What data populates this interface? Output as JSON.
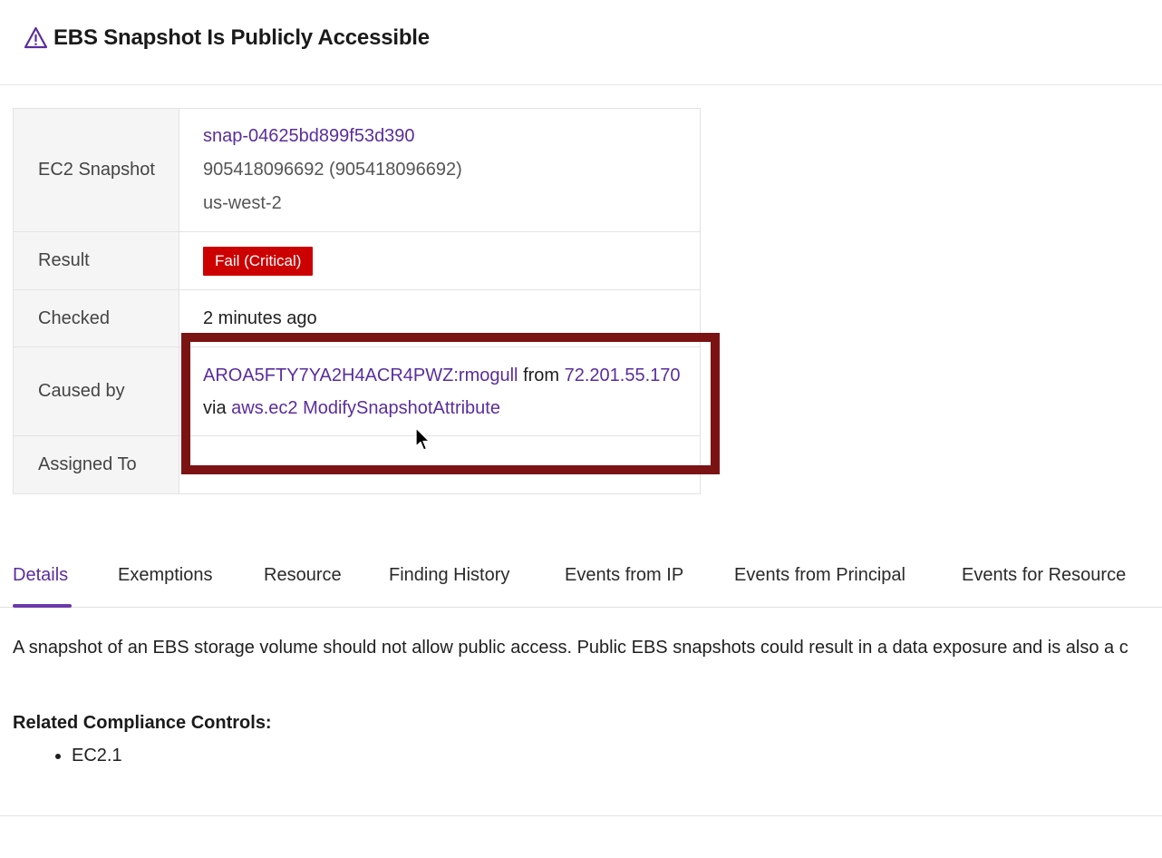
{
  "header": {
    "title": "EBS Snapshot Is Publicly Accessible",
    "icon": "warning-triangle-icon"
  },
  "info": {
    "snapshot_label": "EC2 Snapshot",
    "snapshot_id": "snap-04625bd899f53d390",
    "account": "905418096692 (905418096692)",
    "region": "us-west-2",
    "result_label": "Result",
    "result_value": "Fail (Critical)",
    "checked_label": "Checked",
    "checked_value": "2 minutes ago",
    "caused_label": "Caused by",
    "principal": "AROA5FTY7YA2H4ACR4PWZ:rmogull",
    "from_text": "from",
    "ip": "72.201.55.170",
    "via_text": "via",
    "event": "aws.ec2 ModifySnapshotAttribute",
    "assigned_label": "Assigned To",
    "assigned_value": ""
  },
  "tabs": [
    {
      "label": "Details",
      "active": true
    },
    {
      "label": "Exemptions"
    },
    {
      "label": "Resource"
    },
    {
      "label": "Finding History"
    },
    {
      "label": "Events from IP"
    },
    {
      "label": "Events from Principal"
    },
    {
      "label": "Events for Resource"
    }
  ],
  "details": {
    "description": "A snapshot of an EBS storage volume should not allow public access. Public EBS snapshots could result in a data exposure and is also a c",
    "compliance_title": "Related Compliance Controls:",
    "controls": [
      "EC2.1"
    ]
  },
  "colors": {
    "accent": "#5a2d9e",
    "critical": "#cc0000",
    "highlight_box": "#7b1315"
  }
}
